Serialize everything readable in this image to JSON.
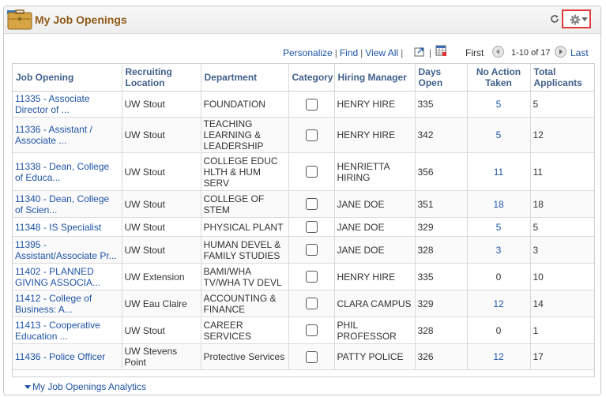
{
  "header": {
    "title": "My Job Openings",
    "icons": {
      "briefcase": "briefcase-icon",
      "refresh": "refresh-icon",
      "gear": "gear-icon"
    }
  },
  "toolbar": {
    "personalize": "Personalize",
    "find": "Find",
    "view_all": "View All",
    "first": "First",
    "range": "1-10 of 17",
    "last": "Last"
  },
  "columns": [
    "Job Opening",
    "Recruiting Location",
    "Department",
    "Category",
    "Hiring Manager",
    "Days Open",
    "No Action Taken",
    "Total Applicants"
  ],
  "rows": [
    {
      "job": "11335 - Associate Director of ...",
      "location": "UW Stout",
      "department": "FOUNDATION",
      "manager": "HENRY HIRE",
      "days": "335",
      "no_action": "5",
      "total": "5"
    },
    {
      "job": "11336 - Assistant / Associate ...",
      "location": "UW Stout",
      "department": "TEACHING LEARNING & LEADERSHIP",
      "manager": "HENRY HIRE",
      "days": "342",
      "no_action": "5",
      "total": "12"
    },
    {
      "job": "11338 - Dean, College of Educa...",
      "location": "UW Stout",
      "department": "COLLEGE EDUC HLTH & HUM SERV",
      "manager": "HENRIETTA HIRING",
      "days": "356",
      "no_action": "11",
      "total": "11"
    },
    {
      "job": "11340 - Dean, College of Scien...",
      "location": "UW Stout",
      "department": "COLLEGE OF STEM",
      "manager": "JANE DOE",
      "days": "351",
      "no_action": "18",
      "total": "18"
    },
    {
      "job": "11348 - IS Specialist",
      "location": "UW Stout",
      "department": "PHYSICAL PLANT",
      "manager": "JANE DOE",
      "days": "329",
      "no_action": "5",
      "total": "5"
    },
    {
      "job": "11395 - Assistant/Associate Pr...",
      "location": "UW Stout",
      "department": "HUMAN DEVEL & FAMILY STUDIES",
      "manager": "JANE DOE",
      "days": "328",
      "no_action": "3",
      "total": "3"
    },
    {
      "job": "11402 - PLANNED GIVING ASSOCIA...",
      "location": "UW Extension",
      "department": "BAMI/WHA TV/WHA TV DEVL",
      "manager": "HENRY HIRE",
      "days": "335",
      "no_action": "0",
      "total": "10"
    },
    {
      "job": "11412 - College of Business: A...",
      "location": "UW Eau Claire",
      "department": "ACCOUNTING & FINANCE",
      "manager": "CLARA CAMPUS",
      "days": "329",
      "no_action": "12",
      "total": "14"
    },
    {
      "job": "11413 - Cooperative Education ...",
      "location": "UW Stout",
      "department": "CAREER SERVICES",
      "manager": "PHIL PROFESSOR",
      "days": "328",
      "no_action": "0",
      "total": "1"
    },
    {
      "job": "11436 - Police Officer",
      "location": "UW Stevens Point",
      "department": "Protective Services",
      "manager": "PATTY POLICE",
      "days": "326",
      "no_action": "12",
      "total": "17"
    }
  ],
  "footer": {
    "analytics": "My Job Openings Analytics"
  }
}
